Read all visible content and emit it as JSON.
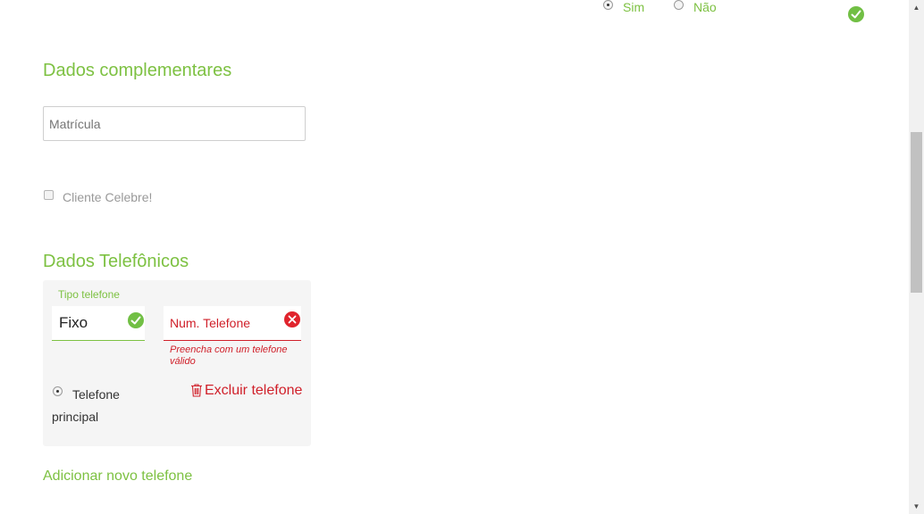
{
  "top_question": {
    "options": [
      {
        "label": "Sim",
        "selected": true
      },
      {
        "label": "Não",
        "selected": false
      }
    ],
    "status_icon": "check-circle-icon"
  },
  "complementary": {
    "title": "Dados complementares",
    "registration_placeholder": "Matrícula",
    "registration_value": "",
    "celebrity_label": "Cliente Celebre!",
    "celebrity_checked": false
  },
  "phones": {
    "title": "Dados Telefônicos",
    "type_label": "Tipo telefone",
    "type_value": "Fixo",
    "number_placeholder": "Num. Telefone",
    "number_value": "",
    "number_error": "Preencha com um telefone válido",
    "primary_label": "Telefone principal",
    "primary_selected": true,
    "delete_label": "Excluir telefone",
    "add_label": "Adicionar novo telefone"
  },
  "colors": {
    "accent_green": "#7dc142",
    "error_red": "#d0202a",
    "card_bg": "#f5f5f5"
  }
}
